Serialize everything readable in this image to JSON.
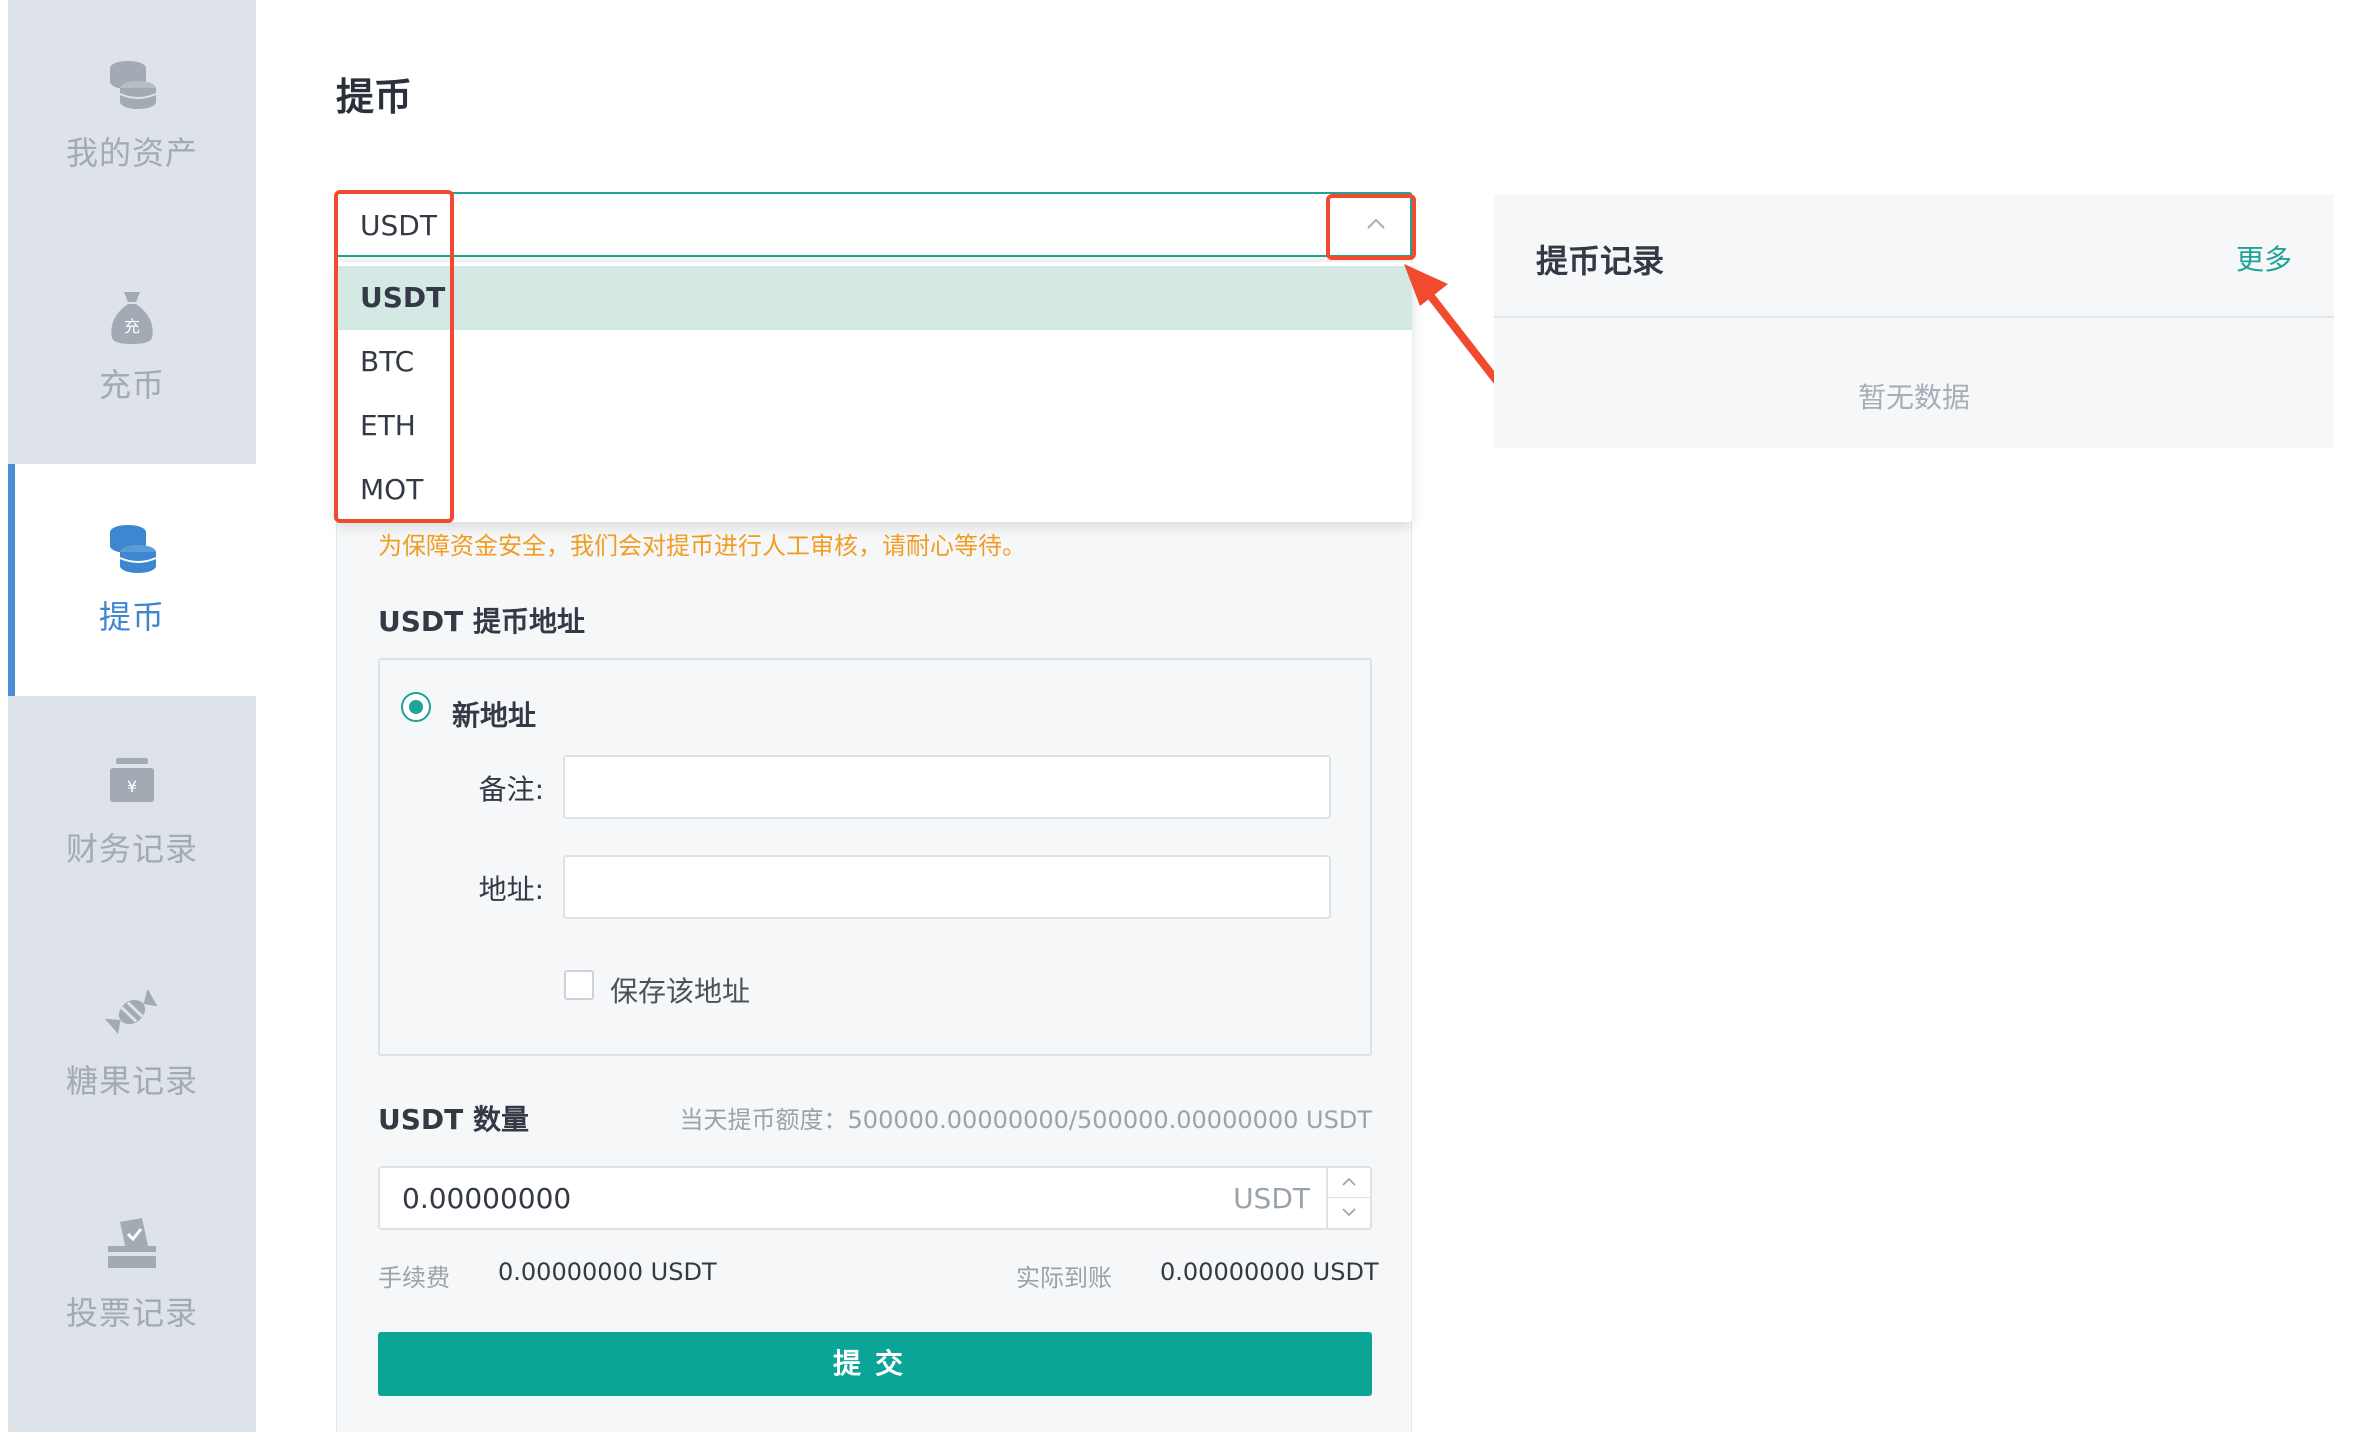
{
  "sidebar": {
    "items": [
      {
        "label": "我的资产",
        "icon": "coin-stack-icon"
      },
      {
        "label": "充币",
        "icon": "money-bag-icon"
      },
      {
        "label": "提币",
        "icon": "coin-stack-icon"
      },
      {
        "label": "财务记录",
        "icon": "cash-box-icon"
      },
      {
        "label": "糖果记录",
        "icon": "candy-icon"
      },
      {
        "label": "投票记录",
        "icon": "ballot-box-icon"
      }
    ],
    "money_bag_glyph": "充",
    "cash_box_glyph": "¥",
    "active_index": 2
  },
  "page": {
    "title": "提币"
  },
  "coin_select": {
    "value": "USDT",
    "open": true,
    "options": [
      "USDT",
      "BTC",
      "ETH",
      "MOT"
    ],
    "selected_option": "USDT"
  },
  "form": {
    "notice": "为保障资金安全，我们会对提币进行人工审核，请耐心等待。",
    "address_section_label": "USDT 提币地址",
    "new_address_label": "新地址",
    "remark_label": "备注:",
    "remark_value": "",
    "address_label": "地址:",
    "address_value": "",
    "save_address_label": "保存该地址",
    "save_address_checked": false,
    "amount_section_label": "USDT 数量",
    "quota_text": "当天提币额度：500000.00000000/500000.00000000 USDT",
    "amount_value": "0.00000000",
    "amount_unit": "USDT",
    "fee_label": "手续费",
    "fee_value": "0.00000000 USDT",
    "received_label": "实际到账",
    "received_value": "0.00000000 USDT",
    "submit_label": "提交"
  },
  "records": {
    "title": "提币记录",
    "more_label": "更多",
    "empty_text": "暂无数据"
  },
  "colors": {
    "accent": "#0aa597",
    "active_nav": "#3f86d0",
    "notice": "#f29d22",
    "annotation": "#f24a2e",
    "sidebar_bg": "#dde3e8"
  }
}
